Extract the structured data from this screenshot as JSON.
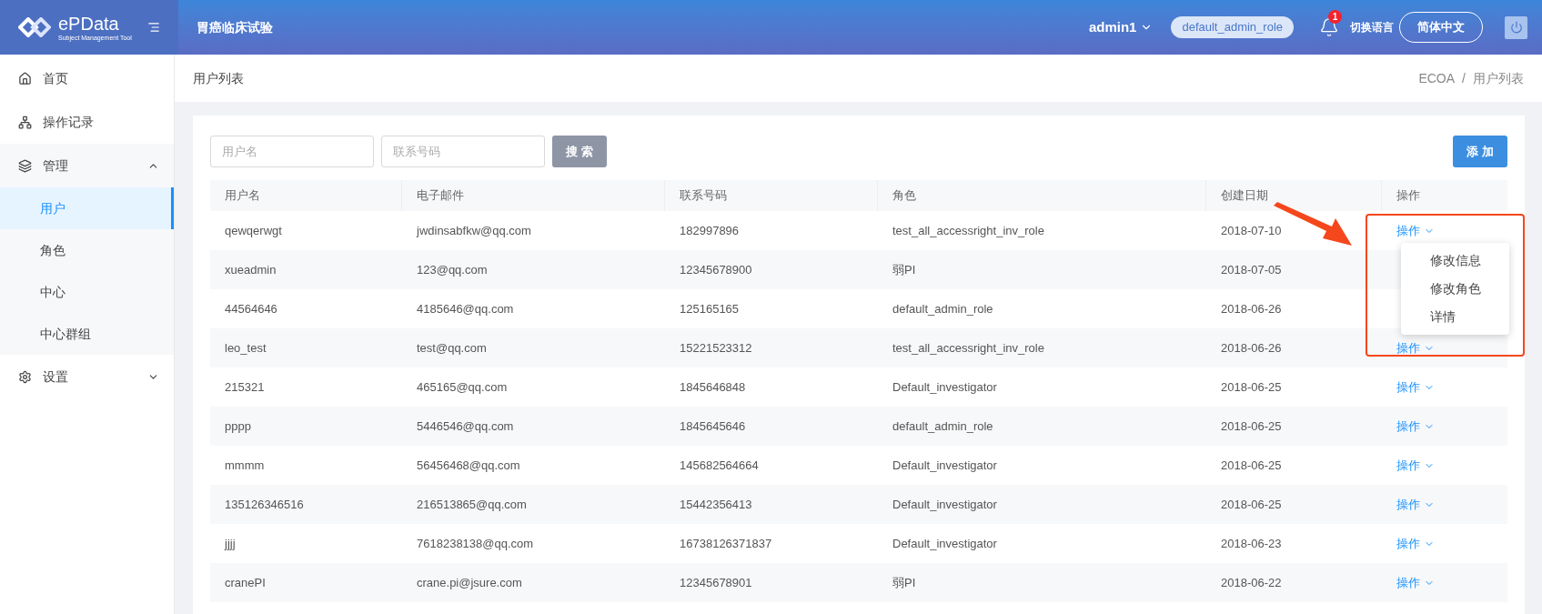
{
  "header": {
    "logo_name": "ePData",
    "logo_subtitle": "Subject Management Tool",
    "project_title": "胃癌临床试验",
    "user": "admin1",
    "role": "default_admin_role",
    "notification_count": "1",
    "language_label": "切换语言",
    "language_button": "简体中文"
  },
  "sidebar": {
    "items": [
      {
        "label": "首页",
        "kind": "home"
      },
      {
        "label": "操作记录",
        "kind": "log"
      },
      {
        "label": "管理",
        "kind": "manage",
        "expanded": true,
        "children": [
          {
            "label": "用户",
            "selected": true
          },
          {
            "label": "角色",
            "selected": false
          },
          {
            "label": "中心",
            "selected": false
          },
          {
            "label": "中心群组",
            "selected": false
          }
        ]
      },
      {
        "label": "设置",
        "kind": "settings",
        "expanded": false
      }
    ]
  },
  "page": {
    "title": "用户列表",
    "breadcrumb": [
      "ECOA",
      "用户列表"
    ],
    "breadcrumb_separator": "/"
  },
  "filters": {
    "username_placeholder": "用户名",
    "phone_placeholder": "联系号码",
    "search_button": "搜 索",
    "add_button": "添 加"
  },
  "table": {
    "columns": [
      "用户名",
      "电子邮件",
      "联系号码",
      "角色",
      "创建日期",
      "操作"
    ],
    "rows": [
      {
        "cells": [
          "qewqerwgt",
          "jwdinsabfkw@qq.com",
          "182997896",
          "test_all_accessright_inv_role",
          "2018-07-10"
        ],
        "action": "操作"
      },
      {
        "cells": [
          "xueadmin",
          "123@qq.com",
          "12345678900",
          "弱PI",
          "2018-07-05"
        ],
        "action": null
      },
      {
        "cells": [
          "44564646",
          "4185646@qq.com",
          "125165165",
          "default_admin_role",
          "2018-06-26"
        ],
        "action": null
      },
      {
        "cells": [
          "leo_test",
          "test@qq.com",
          "15221523312",
          "test_all_accessright_inv_role",
          "2018-06-26"
        ],
        "action": "操作"
      },
      {
        "cells": [
          "215321",
          "465165@qq.com",
          "1845646848",
          "Default_investigator",
          "2018-06-25"
        ],
        "action": "操作"
      },
      {
        "cells": [
          "pppp",
          "5446546@qq.com",
          "1845645646",
          "default_admin_role",
          "2018-06-25"
        ],
        "action": "操作"
      },
      {
        "cells": [
          "mmmm",
          "56456468@qq.com",
          "145682564664",
          "Default_investigator",
          "2018-06-25"
        ],
        "action": "操作"
      },
      {
        "cells": [
          "135126346516",
          "216513865@qq.com",
          "15442356413",
          "Default_investigator",
          "2018-06-25"
        ],
        "action": "操作"
      },
      {
        "cells": [
          "jjjj",
          "7618238138@qq.com",
          "16738126371837",
          "Default_investigator",
          "2018-06-23"
        ],
        "action": "操作"
      },
      {
        "cells": [
          "cranePI",
          "crane.pi@jsure.com",
          "12345678901",
          "弱PI",
          "2018-06-22"
        ],
        "action": "操作"
      }
    ]
  },
  "dropdown_menu": {
    "open": true,
    "items": [
      "修改信息",
      "修改角色",
      "详情"
    ]
  }
}
